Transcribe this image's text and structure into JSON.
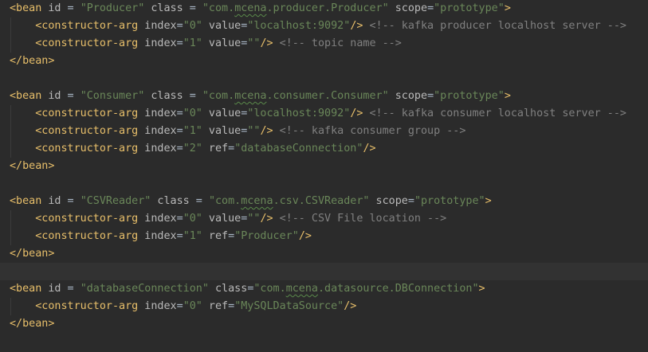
{
  "colors": {
    "background": "#2b2b2b",
    "current_line": "#323232",
    "tag": "#e8bf6a",
    "attribute": "#bababa",
    "string": "#6a8759",
    "comment": "#808080"
  },
  "code": {
    "l1": {
      "t0": "<bean",
      "t1": " id",
      "t2": " = ",
      "t3": "\"Producer\"",
      "t4": " class",
      "t5": " = ",
      "t6a": "\"com.",
      "t6b": "mcena",
      "t6c": ".producer.Producer\"",
      "t7": " scope",
      "t8": "=",
      "t9": "\"prototype\"",
      "t10": ">"
    },
    "l2": {
      "t0": "<constructor-arg",
      "t1": " index",
      "t2": "=",
      "t3": "\"0\"",
      "t4": " value",
      "t5": "=",
      "t6": "\"localhost:9092\"",
      "t7": "/>",
      "t8": " <!-- kafka producer localhost server -->"
    },
    "l3": {
      "t0": "<constructor-arg",
      "t1": " index",
      "t2": "=",
      "t3": "\"1\"",
      "t4": " value",
      "t5": "=",
      "t6": "\"\"",
      "t7": "/>",
      "t8": " <!-- topic name -->"
    },
    "l4": {
      "t0": "</bean>"
    },
    "l6": {
      "t0": "<bean",
      "t1": " id",
      "t2": " = ",
      "t3": "\"Consumer\"",
      "t4": " class",
      "t5": " = ",
      "t6a": "\"com.",
      "t6b": "mcena",
      "t6c": ".consumer.Consumer\"",
      "t7": " scope",
      "t8": "=",
      "t9": "\"prototype\"",
      "t10": ">"
    },
    "l7": {
      "t0": "<constructor-arg",
      "t1": " index",
      "t2": "=",
      "t3": "\"0\"",
      "t4": " value",
      "t5": "=",
      "t6": "\"localhost:9092\"",
      "t7": "/>",
      "t8": " <!-- kafka consumer localhost server -->"
    },
    "l8": {
      "t0": "<constructor-arg",
      "t1": " index",
      "t2": "=",
      "t3": "\"1\"",
      "t4": " value",
      "t5": "=",
      "t6": "\"\"",
      "t7": "/>",
      "t8": " <!-- kafka consumer group -->"
    },
    "l9": {
      "t0": "<constructor-arg",
      "t1": " index",
      "t2": "=",
      "t3": "\"2\"",
      "t4": " ref",
      "t5": "=",
      "t6": "\"databaseConnection\"",
      "t7": "/>"
    },
    "l10": {
      "t0": "</bean>"
    },
    "l12": {
      "t0": "<bean",
      "t1": " id",
      "t2": " = ",
      "t3": "\"CSVReader\"",
      "t4": " class",
      "t5": " = ",
      "t6a": "\"com.",
      "t6b": "mcena",
      "t6c": ".csv.CSVReader\"",
      "t7": " scope",
      "t8": "=",
      "t9": "\"prototype\"",
      "t10": ">"
    },
    "l13": {
      "t0": "<constructor-arg",
      "t1": " index",
      "t2": "=",
      "t3": "\"0\"",
      "t4": " value",
      "t5": "=",
      "t6": "\"\"",
      "t7": "/>",
      "t8": " <!-- CSV File location -->"
    },
    "l14": {
      "t0": "<constructor-arg",
      "t1": " index",
      "t2": "=",
      "t3": "\"1\"",
      "t4": " ref",
      "t5": "=",
      "t6": "\"Producer\"",
      "t7": "/>"
    },
    "l15": {
      "t0": "</bean>"
    },
    "l17": {
      "t0": "<bean",
      "t1": " id",
      "t2": " = ",
      "t3": "\"databaseConnection\"",
      "t4": " class",
      "t5": "=",
      "t6a": "\"com.",
      "t6b": "mcena",
      "t6c": ".datasource.DBConnection\"",
      "t7": ">"
    },
    "l18": {
      "t0": "<constructor-arg",
      "t1": " index",
      "t2": "=",
      "t3": "\"0\"",
      "t4": " ref",
      "t5": "=",
      "t6": "\"MySQLDataSource\"",
      "t7": "/>"
    },
    "l19": {
      "t0": "</bean>"
    }
  }
}
